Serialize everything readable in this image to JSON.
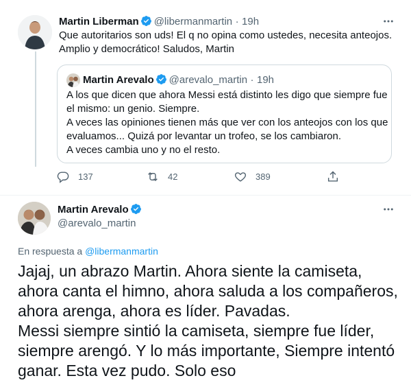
{
  "tweet1": {
    "name": "Martin Liberman",
    "handle": "@libermanmartin",
    "separator": "·",
    "time": "19h",
    "text_lines": [
      "Que autoritarios son uds! El q no opina como ustedes, necesita anteojos.",
      "Amplio y democrático! Saludos, Martin"
    ],
    "quote": {
      "name": "Martin Arevalo",
      "handle": "@arevalo_martin",
      "separator": "·",
      "time": "19h",
      "text_lines": [
        "A los que dicen que ahora Messi está distinto les digo que siempre fue",
        "el mismo: un genio. Siempre.",
        "A veces las opiniones tienen más que ver con los anteojos con los que",
        "evaluamos... Quizá por levantar un trofeo, se los cambiaron.",
        "A veces cambia uno y no el resto."
      ]
    },
    "actions": {
      "replies": "137",
      "retweets": "42",
      "likes": "389"
    }
  },
  "tweet2": {
    "name": "Martin Arevalo",
    "handle": "@arevalo_martin",
    "reply_prefix": "En respuesta a ",
    "reply_to": "@libermanmartin",
    "text_lines": [
      "Jajaj, un abrazo Martin. Ahora siente la camiseta,",
      "ahora canta el himno, ahora saluda a los compañeros,",
      "ahora arenga, ahora es líder. Pavadas.",
      "Messi siempre sintió la camiseta, siempre fue líder,",
      "siempre arengó. Y lo más importante, Siempre intentó",
      "ganar. Esta vez pudo. Solo eso"
    ]
  },
  "colors": {
    "accent": "#1d9bf0",
    "text": "#0f1419",
    "muted": "#536471",
    "border": "#cfd9de"
  }
}
